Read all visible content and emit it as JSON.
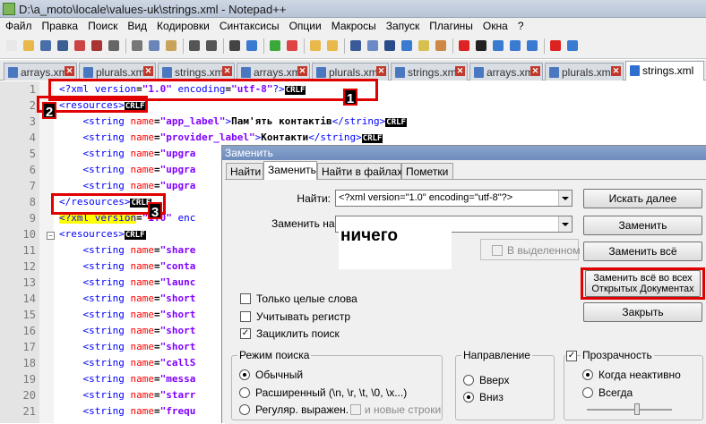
{
  "window": {
    "title": "D:\\a_moto\\locale\\values-uk\\strings.xml - Notepad++"
  },
  "menu": [
    "Файл",
    "Правка",
    "Поиск",
    "Вид",
    "Кодировки",
    "Синтаксисы",
    "Опции",
    "Макросы",
    "Запуск",
    "Плагины",
    "Окна",
    "?"
  ],
  "tabs": [
    {
      "label": "arrays.xml"
    },
    {
      "label": "plurals.xml"
    },
    {
      "label": "strings.xml"
    },
    {
      "label": "arrays.xml"
    },
    {
      "label": "plurals.xml"
    },
    {
      "label": "strings.xml"
    },
    {
      "label": "arrays.xml"
    },
    {
      "label": "plurals.xml"
    },
    {
      "label": "strings.xml"
    }
  ],
  "editor": {
    "lines": [
      {
        "n": "1",
        "t1": "<?xml version",
        "t2": "\"1.0\"",
        "t3": " encoding",
        "t4": "\"utf-8\"",
        "t5": "?>",
        "eol": "CRLF"
      },
      {
        "n": "2",
        "tag": "<resources>",
        "eol": "CRLF"
      },
      {
        "n": "3",
        "indent": "    ",
        "open": "<string",
        "attr": " name",
        "val": "\"app_label\"",
        "gt": ">",
        "text": "Пам'ять контактів",
        "close": "</string>",
        "eol": "CRLF"
      },
      {
        "n": "4",
        "indent": "    ",
        "open": "<string",
        "attr": " name",
        "val": "\"provider_label\"",
        "gt": ">",
        "text": "Контакти",
        "close": "</string>",
        "eol": "CRLF"
      },
      {
        "n": "5",
        "indent": "    ",
        "open": "<string",
        "attr": " name",
        "val": "\"upgra",
        "gt": "",
        "text": "",
        "close": "",
        "eol": ""
      },
      {
        "n": "6",
        "indent": "    ",
        "open": "<string",
        "attr": " name",
        "val": "\"upgra",
        "gt": "",
        "text": "",
        "close": "",
        "eol": ""
      },
      {
        "n": "7",
        "indent": "    ",
        "open": "<string",
        "attr": " name",
        "val": "\"upgra",
        "gt": "",
        "text": "",
        "close": "",
        "eol": ""
      },
      {
        "n": "8",
        "tag": "</resources>",
        "eol": "CRLF"
      },
      {
        "n": "9",
        "t1": "<?xml version",
        "t2": "\"1.0\"",
        "t3": " enc",
        "t4": "",
        "t5": "",
        "eol": ""
      },
      {
        "n": "10",
        "tag": "<resources>",
        "eol": "CRLF"
      },
      {
        "n": "11",
        "indent": "    ",
        "open": "<string",
        "attr": " name",
        "val": "\"share",
        "gt": "",
        "text": "",
        "close": "",
        "eol": ""
      },
      {
        "n": "12",
        "indent": "    ",
        "open": "<string",
        "attr": " name",
        "val": "\"conta",
        "gt": "",
        "text": "",
        "close": "",
        "eol": ""
      },
      {
        "n": "13",
        "indent": "    ",
        "open": "<string",
        "attr": " name",
        "val": "\"launc",
        "gt": "",
        "text": "",
        "close": "",
        "eol": ""
      },
      {
        "n": "14",
        "indent": "    ",
        "open": "<string",
        "attr": " name",
        "val": "\"short",
        "gt": "",
        "text": "",
        "close": "",
        "eol": ""
      },
      {
        "n": "15",
        "indent": "    ",
        "open": "<string",
        "attr": " name",
        "val": "\"short",
        "gt": "",
        "text": "",
        "close": "",
        "eol": ""
      },
      {
        "n": "16",
        "indent": "    ",
        "open": "<string",
        "attr": " name",
        "val": "\"short",
        "gt": "",
        "text": "",
        "close": "",
        "eol": ""
      },
      {
        "n": "17",
        "indent": "    ",
        "open": "<string",
        "attr": " name",
        "val": "\"short",
        "gt": "",
        "text": "",
        "close": "",
        "eol": ""
      },
      {
        "n": "18",
        "indent": "    ",
        "open": "<string",
        "attr": " name",
        "val": "\"callS",
        "gt": "",
        "text": "",
        "close": "",
        "eol": ""
      },
      {
        "n": "19",
        "indent": "    ",
        "open": "<string",
        "attr": " name",
        "val": "\"messa",
        "gt": "",
        "text": "",
        "close": "",
        "eol": ""
      },
      {
        "n": "20",
        "indent": "    ",
        "open": "<string",
        "attr": " name",
        "val": "\"starr",
        "gt": "",
        "text": "",
        "close": "",
        "eol": ""
      },
      {
        "n": "21",
        "indent": "    ",
        "open": "<string",
        "attr": " name",
        "val": "\"frequ",
        "gt": "",
        "text": "",
        "close": "",
        "eol": ""
      }
    ]
  },
  "annotations": {
    "n1": "1",
    "n2": "2",
    "n3": "3"
  },
  "dialog": {
    "title": "Заменить",
    "tabs": [
      "Найти",
      "Заменить",
      "Найти в файлах",
      "Пометки"
    ],
    "find_label": "Найти:",
    "find_value": "<?xml version=\"1.0\" encoding=\"utf-8\"?>",
    "replace_label": "Заменить на:",
    "replace_overlay": "ничего",
    "buttons": {
      "find_next": "Искать далее",
      "replace": "Заменить",
      "replace_all": "Заменить всё",
      "replace_all_open_1": "Заменить всё во всех",
      "replace_all_open_2": "Открытых Документах",
      "close": "Закрыть"
    },
    "in_selection": "В выделенном",
    "options": {
      "whole_word": "Только целые слова",
      "match_case": "Учитывать регистр",
      "wrap": "Зациклить поиск"
    },
    "search_mode": {
      "title": "Режим поиска",
      "normal": "Обычный",
      "extended": "Расширенный (\\n, \\r, \\t, \\0, \\x...)",
      "regex": "Регуляр. выражен.",
      "newlines": "и новые строки"
    },
    "direction": {
      "title": "Направление",
      "up": "Вверх",
      "down": "Вниз"
    },
    "transparency": {
      "title": "Прозрачность",
      "inactive": "Когда неактивно",
      "always": "Всегда"
    }
  }
}
